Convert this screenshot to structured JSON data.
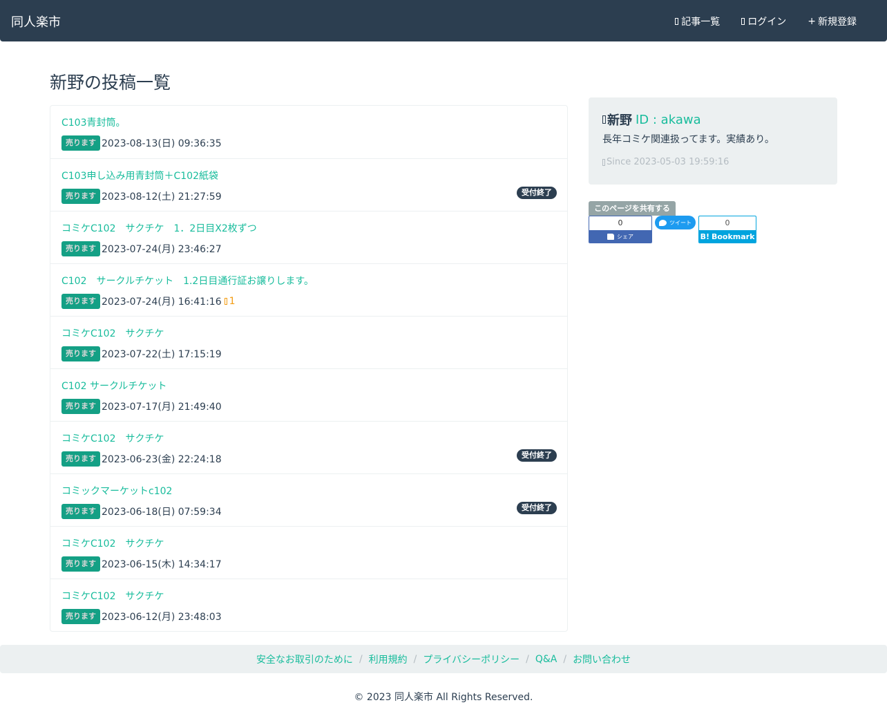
{
  "navbar": {
    "brand": "同人楽市",
    "links": [
      {
        "label": "記事一覧",
        "icon": "list-icon"
      },
      {
        "label": "ログイン",
        "icon": "login-icon"
      },
      {
        "label": "新規登録",
        "icon": "plus-icon"
      }
    ]
  },
  "page": {
    "title": "新野の投稿一覧"
  },
  "posts": [
    {
      "title": "C103青封筒。",
      "badge": "売ります",
      "date": "2023-08-13(日) 09:36:35",
      "status": "",
      "comments": ""
    },
    {
      "title": "C103申し込み用青封筒＋C102紙袋",
      "badge": "売ります",
      "date": "2023-08-12(土) 21:27:59",
      "status": "受付終了",
      "comments": ""
    },
    {
      "title": "コミケC102　サクチケ　1．2日目X2枚ずつ",
      "badge": "売ります",
      "date": "2023-07-24(月) 23:46:27",
      "status": "",
      "comments": ""
    },
    {
      "title": "C102　サークルチケット　1.2日目通行証お譲りします。",
      "badge": "売ります",
      "date": "2023-07-24(月) 16:41:16",
      "status": "",
      "comments": "1"
    },
    {
      "title": "コミケC102　サクチケ",
      "badge": "売ります",
      "date": "2023-07-22(土) 17:15:19",
      "status": "",
      "comments": ""
    },
    {
      "title": "C102 サークルチケット",
      "badge": "売ります",
      "date": "2023-07-17(月) 21:49:40",
      "status": "",
      "comments": ""
    },
    {
      "title": "コミケC102　サクチケ",
      "badge": "売ります",
      "date": "2023-06-23(金) 22:24:18",
      "status": "受付終了",
      "comments": ""
    },
    {
      "title": "コミックマーケットc102",
      "badge": "売ります",
      "date": "2023-06-18(日) 07:59:34",
      "status": "受付終了",
      "comments": ""
    },
    {
      "title": "コミケC102　サクチケ",
      "badge": "売ります",
      "date": "2023-06-15(木) 14:34:17",
      "status": "",
      "comments": ""
    },
    {
      "title": "コミケC102　サクチケ",
      "badge": "売ります",
      "date": "2023-06-12(月) 23:48:03",
      "status": "",
      "comments": ""
    }
  ],
  "profile": {
    "name": "新野",
    "id_label": "ID : akawa",
    "bio": "長年コミケ関連扱ってます。実績あり。",
    "since": "Since 2023-05-03 19:59:16"
  },
  "share": {
    "label": "このページを共有する",
    "facebook": {
      "count": "0",
      "label": "シェア"
    },
    "twitter": {
      "label": "ツイート"
    },
    "hatena": {
      "count": "0",
      "label": "Bookmark",
      "mark": "B!"
    }
  },
  "footer": {
    "links": [
      "安全なお取引のために",
      "利用規約",
      "プライバシーポリシー",
      "Q&A",
      "お問い合わせ"
    ],
    "separator": "/",
    "copyright": "© 2023 同人楽市 All Rights Reserved."
  },
  "colors": {
    "primary": "#2c3e50",
    "success": "#18bc9c",
    "warning": "#f39c12",
    "light": "#ecf0f1",
    "muted": "#b4bcc2"
  }
}
